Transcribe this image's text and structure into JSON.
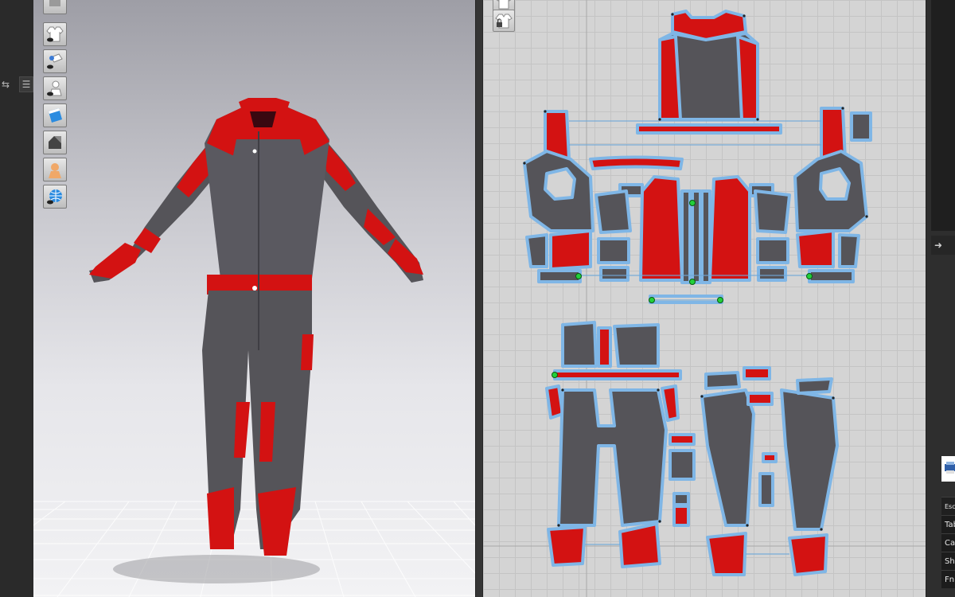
{
  "right_panel": {
    "items": [
      "Esc",
      "Tab",
      "Ca",
      "Sh",
      "Fn"
    ]
  },
  "colors": {
    "garment_red": "#d31212",
    "garment_gray": "#555459",
    "pattern_outline": "#7fb6e6",
    "pattern_bg": "#d4d4d4"
  },
  "icons": {
    "tool_column": [
      "show-garment-icon",
      "show-pins-icon",
      "show-avatar-icon",
      "texture-icon",
      "shading-icon",
      "skin-icon",
      "environment-icon"
    ],
    "pattern_toolbar": [
      "garment-icon",
      "lock-icon"
    ]
  }
}
